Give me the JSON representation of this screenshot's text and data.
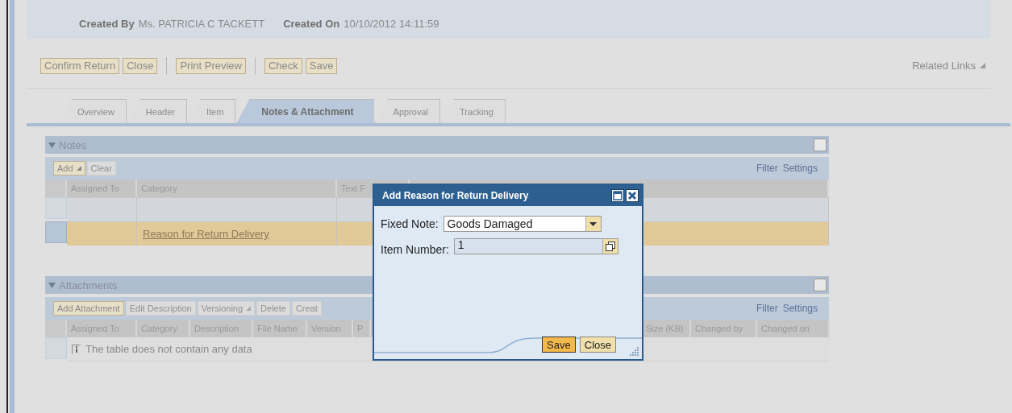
{
  "header": {
    "created_by_label": "Created By",
    "created_by": "Ms. PATRICIA C TACKETT",
    "created_on_label": "Created On",
    "created_on": "10/10/2012 14:11:59"
  },
  "toolbar": {
    "groups": [
      [
        {
          "label": "Confirm Return"
        },
        {
          "label": "Close"
        }
      ],
      [
        {
          "label": "Print Preview"
        }
      ],
      [
        {
          "label": "Check"
        },
        {
          "label": "Save"
        }
      ]
    ],
    "related_links": "Related Links"
  },
  "tabs": [
    {
      "label": "Overview",
      "selected": false
    },
    {
      "label": "Header",
      "selected": false
    },
    {
      "label": "Item",
      "selected": false
    },
    {
      "label": "Notes & Attachment",
      "selected": true
    },
    {
      "label": "Approval",
      "selected": false
    },
    {
      "label": "Tracking",
      "selected": false
    }
  ],
  "notes": {
    "title": "Notes",
    "expanded": true,
    "buttons": [
      {
        "label": "Add",
        "disabled": false,
        "menu": true
      },
      {
        "label": "Clear",
        "disabled": true,
        "menu": false
      }
    ],
    "filter": "Filter",
    "settings": "Settings",
    "columns": [
      "Assigned To",
      "Category",
      "Text F"
    ],
    "rows": [
      {
        "selected": false
      },
      {
        "selected": true,
        "category": "Reason for Return Delivery"
      }
    ]
  },
  "attachments": {
    "title": "Attachments",
    "expanded": true,
    "buttons": [
      {
        "label": "Add Attachment",
        "disabled": false,
        "menu": false
      },
      {
        "label": "Edit Description",
        "disabled": true,
        "menu": false
      },
      {
        "label": "Versioning",
        "disabled": true,
        "menu": true
      },
      {
        "label": "Delete",
        "disabled": true,
        "menu": false
      },
      {
        "label": "Creat",
        "disabled": true,
        "menu": false
      }
    ],
    "filter": "Filter",
    "settings": "Settings",
    "columns": [
      "Assigned To",
      "Category",
      "Description",
      "File Name",
      "Version",
      "P"
    ],
    "columns_right": [
      "Size (KB)",
      "Changed by",
      "Changed on"
    ],
    "empty_message": "The table does not contain any data"
  },
  "dialog": {
    "title": "Add Reason for Return Delivery",
    "fields": [
      {
        "kind": "dropdown",
        "label": "Fixed Note:",
        "value": "Goods Damaged"
      },
      {
        "kind": "lookup",
        "label": "Item Number:",
        "value": "1"
      }
    ],
    "buttons": [
      {
        "label": "Save",
        "emphasized": true
      },
      {
        "label": "Close",
        "emphasized": false
      }
    ]
  }
}
